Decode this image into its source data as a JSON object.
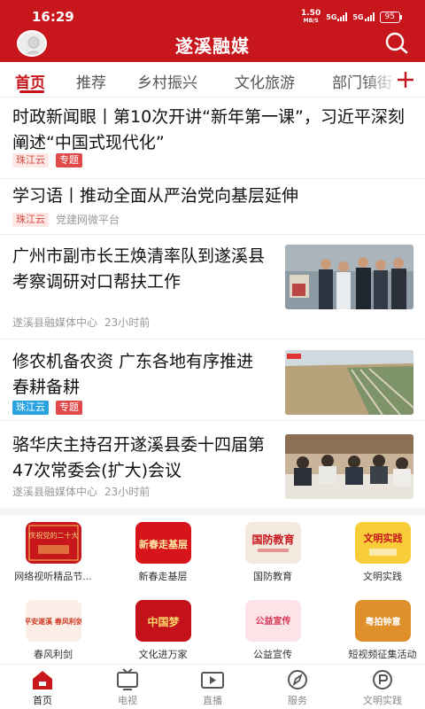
{
  "status_bar": {
    "time": "16:29",
    "net_speed": "1.50",
    "net_unit": "MB/S",
    "signal1": "5G",
    "signal2": "5G",
    "battery": "95"
  },
  "header": {
    "title": "遂溪融媒",
    "icons": {
      "avatar": "user-avatar",
      "search": "search-icon"
    },
    "color": "#c8161d"
  },
  "tabs": {
    "items": [
      "首页",
      "推荐",
      "乡村振兴",
      "文化旅游",
      "部门镇街"
    ],
    "active_index": 0,
    "add_icon": "plus-icon"
  },
  "news": [
    {
      "title": "时政新闻眼丨第10次开讲“新年第一课”，习近平深刻阐述“中国式现代化”",
      "tags": [
        {
          "text": "珠江云",
          "style": "pink"
        },
        {
          "text": "专题",
          "style": "red"
        }
      ],
      "source": "",
      "time": ""
    },
    {
      "title": "学习语丨推动全面从严治党向基层延伸",
      "tags": [
        {
          "text": "珠江云",
          "style": "pink"
        }
      ],
      "source": "党建网微平台",
      "time": ""
    },
    {
      "title": "广州市副市长王焕清率队到遂溪县考察调研对口帮扶工作",
      "tags": [],
      "source": "遂溪县融媒体中心",
      "time": "23小时前"
    },
    {
      "title": "修农机备农资 广东各地有序推进春耕备耕",
      "tags": [
        {
          "text": "珠江云",
          "style": "blue"
        },
        {
          "text": "专题",
          "style": "red"
        }
      ],
      "source": "",
      "time": ""
    },
    {
      "title": "骆华庆主持召开遂溪县委十四届第47次常委会(扩大)会议",
      "tags": [],
      "source": "遂溪县融媒体中心",
      "time": "23小时前"
    }
  ],
  "grid": [
    {
      "label": "网络视听精品节...",
      "icon": "audiovisual-icon",
      "art": "庆祝党的二十大"
    },
    {
      "label": "新春走基层",
      "icon": "spring-festival-icon",
      "art": "新春走基层"
    },
    {
      "label": "国防教育",
      "icon": "national-defense-icon",
      "art": "国防教育"
    },
    {
      "label": "文明实践",
      "icon": "civilization-practice-icon",
      "art": "文明实践"
    },
    {
      "label": "春风利剑",
      "icon": "spring-breeze-icon",
      "art": "平安遂溪 春风利剑"
    },
    {
      "label": "文化进万家",
      "icon": "culture-icon",
      "art": "中国梦"
    },
    {
      "label": "公益宣传",
      "icon": "public-welfare-icon",
      "art": "公益宣传"
    },
    {
      "label": "短视频征集活动",
      "icon": "short-video-icon",
      "art": "粤拍钟意"
    }
  ],
  "bottom_nav": {
    "items": [
      {
        "label": "首页",
        "icon": "home-icon"
      },
      {
        "label": "电视",
        "icon": "tv-icon"
      },
      {
        "label": "直播",
        "icon": "live-icon"
      },
      {
        "label": "服务",
        "icon": "compass-icon"
      },
      {
        "label": "文明实践",
        "icon": "civilization-icon"
      }
    ],
    "active_index": 0
  }
}
